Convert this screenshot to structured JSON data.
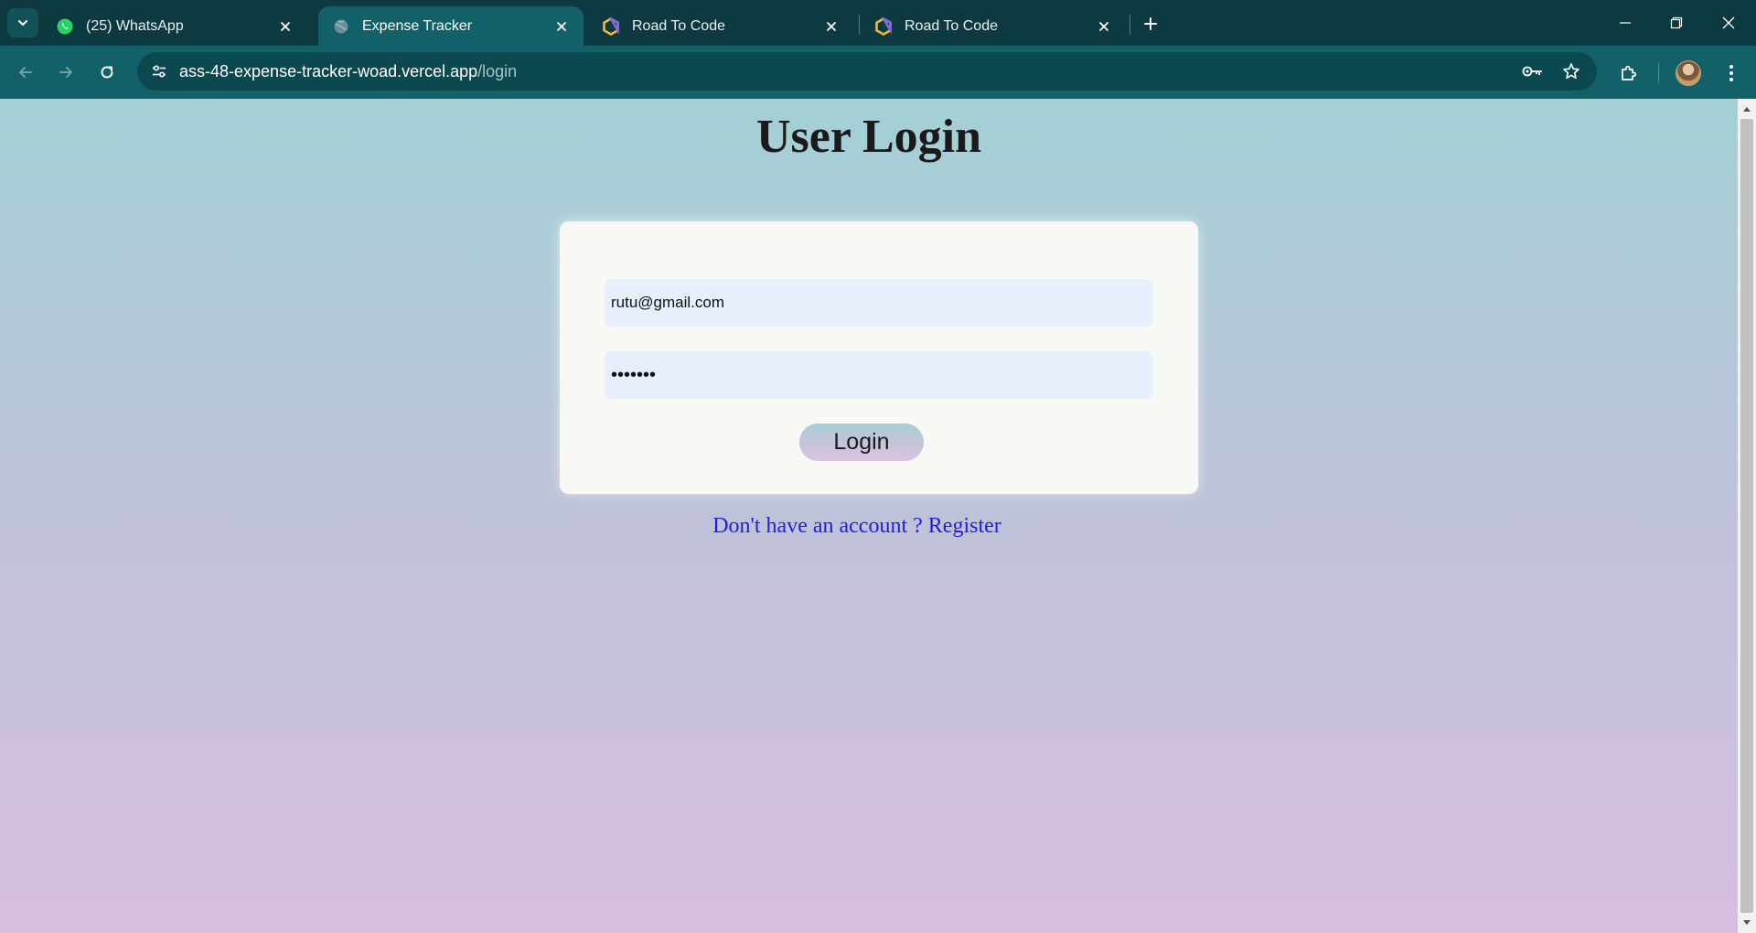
{
  "browser": {
    "tabs": [
      {
        "title": "(25) WhatsApp",
        "icon": "whatsapp-icon",
        "active": false
      },
      {
        "title": "Expense Tracker",
        "icon": "globe-icon",
        "active": true
      },
      {
        "title": "Road To Code",
        "icon": "hexagon-logo-icon",
        "active": false
      },
      {
        "title": "Road To Code",
        "icon": "hexagon-logo-icon",
        "active": false
      }
    ],
    "url_host": "ass-48-expense-tracker-woad.vercel.app",
    "url_path": "/login"
  },
  "page": {
    "title": "User Login",
    "email_value": "rutu@gmail.com",
    "password_value": "•••••••",
    "login_label": "Login",
    "register_text": "Don't have an account ? Register"
  },
  "colors": {
    "tabstrip": "#0c3a40",
    "toolbar": "#136168",
    "link": "#1e1ee0"
  }
}
